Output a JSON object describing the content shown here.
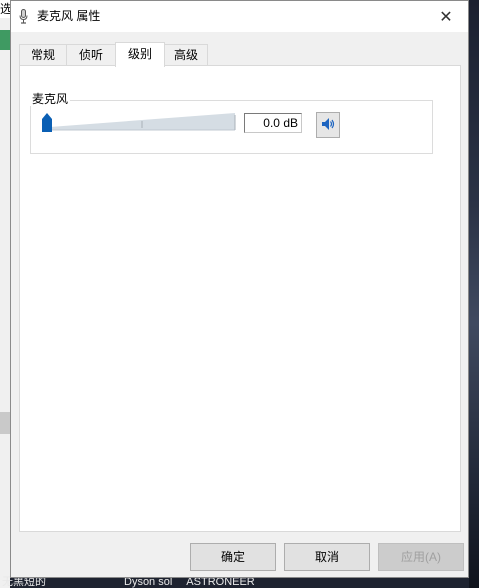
{
  "background": {
    "left_edge_text": "选",
    "taskbar_items": [
      "无黑短的",
      "Dyson sol",
      "ASTRONEER"
    ]
  },
  "dialog": {
    "title": "麦克风 属性",
    "close_glyph": "✕",
    "tabs": [
      {
        "label": "常规",
        "active": false
      },
      {
        "label": "侦听",
        "active": false
      },
      {
        "label": "级别",
        "active": true
      },
      {
        "label": "高级",
        "active": false
      }
    ],
    "levels": {
      "group_label": "麦克风",
      "slider_level_fraction": 0.0,
      "value_text": "0.0 dB",
      "mute_button_icon": "speaker-icon"
    },
    "buttons": {
      "ok": "确定",
      "cancel": "取消",
      "apply": "应用(A)"
    }
  },
  "colors": {
    "slider_thumb": "#0a5fb4",
    "slider_track": "#c9d3dc"
  }
}
